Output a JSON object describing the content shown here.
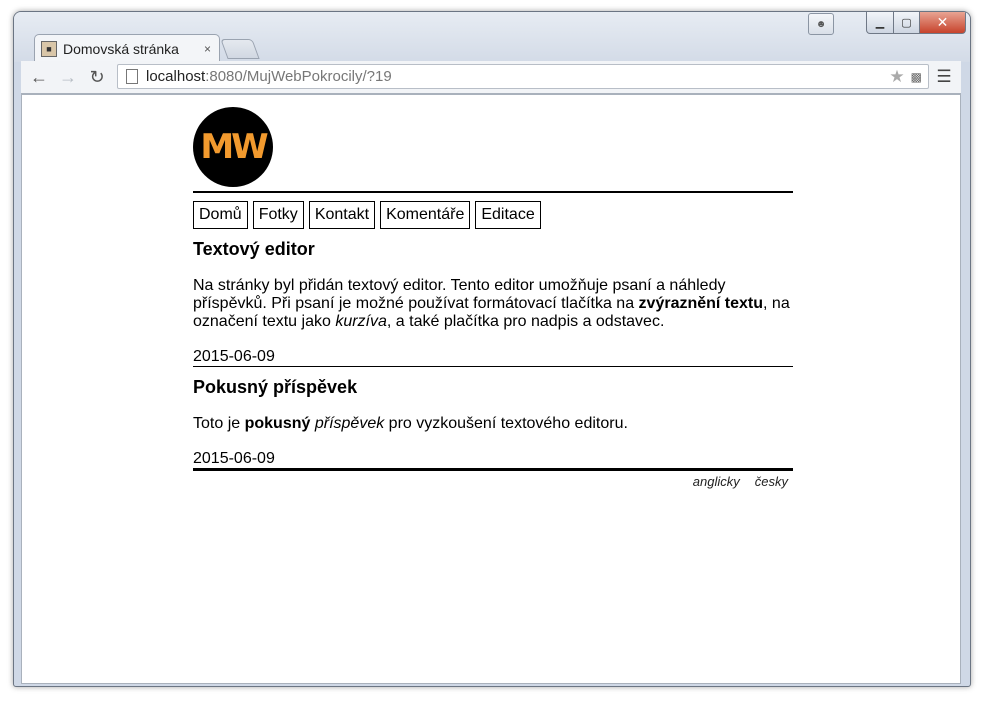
{
  "browser": {
    "tab_title": "Domovská stránka",
    "tab_close": "×",
    "url_host": "localhost",
    "url_rest": ":8080/MujWebPokrocily/?19",
    "controls": {
      "minimize": "▁",
      "maximize": "▢",
      "close": "✕"
    }
  },
  "site": {
    "logo_text": "MW",
    "nav": [
      "Domů",
      "Fotky",
      "Kontakt",
      "Komentáře",
      "Editace"
    ],
    "posts": [
      {
        "title": "Textový editor",
        "body_1": "Na stránky byl přidán textový editor. Tento editor umožňuje psaní a náhledy příspěvků. Při psaní je možné používat formátovací tlačítka na ",
        "bold_1": "zvýraznění textu",
        "body_2": ", na označení textu jako ",
        "italic_1": "kurzíva",
        "body_3": ", a také plačítka pro nadpis a odstavec.",
        "date": "2015-06-09"
      },
      {
        "title": "Pokusný příspěvek",
        "body_1": "Toto je ",
        "bold_1": "pokusný",
        "body_2": " ",
        "italic_1": "příspěvek",
        "body_3": " pro vyzkoušení textového editoru.",
        "date": "2015-06-09"
      }
    ],
    "languages": [
      "anglicky",
      "česky"
    ]
  }
}
